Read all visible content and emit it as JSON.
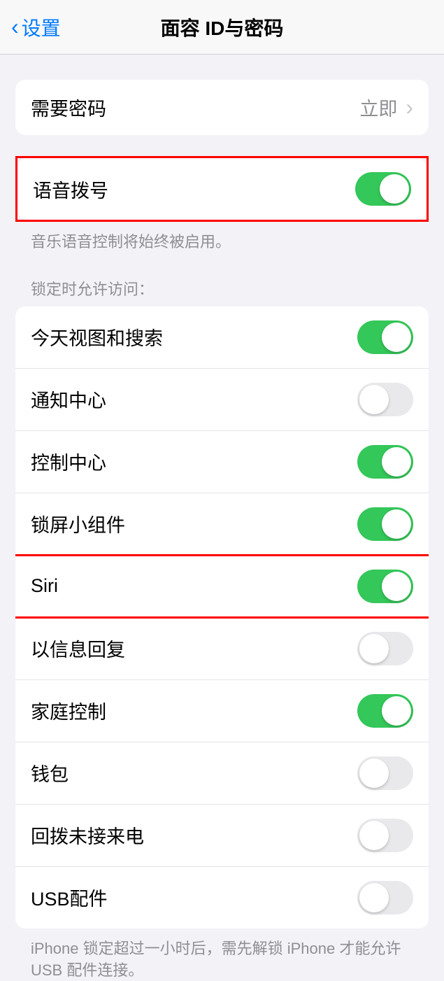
{
  "header": {
    "back_label": "设置",
    "title": "面容 ID与密码"
  },
  "passcode": {
    "label": "需要密码",
    "value": "立即"
  },
  "voice_dial": {
    "label": "语音拨号",
    "on": true,
    "footer": "音乐语音控制将始终被启用。"
  },
  "lock_section": {
    "header": "锁定时允许访问：",
    "items": [
      {
        "label": "今天视图和搜索",
        "on": true
      },
      {
        "label": "通知中心",
        "on": false
      },
      {
        "label": "控制中心",
        "on": true
      },
      {
        "label": "锁屏小组件",
        "on": true
      },
      {
        "label": "Siri",
        "on": true
      },
      {
        "label": "以信息回复",
        "on": false
      },
      {
        "label": "家庭控制",
        "on": true
      },
      {
        "label": "钱包",
        "on": false
      },
      {
        "label": "回拨未接来电",
        "on": false
      },
      {
        "label": "USB配件",
        "on": false
      }
    ],
    "footer": "iPhone 锁定超过一小时后，需先解锁 iPhone 才能允许USB 配件连接。"
  }
}
